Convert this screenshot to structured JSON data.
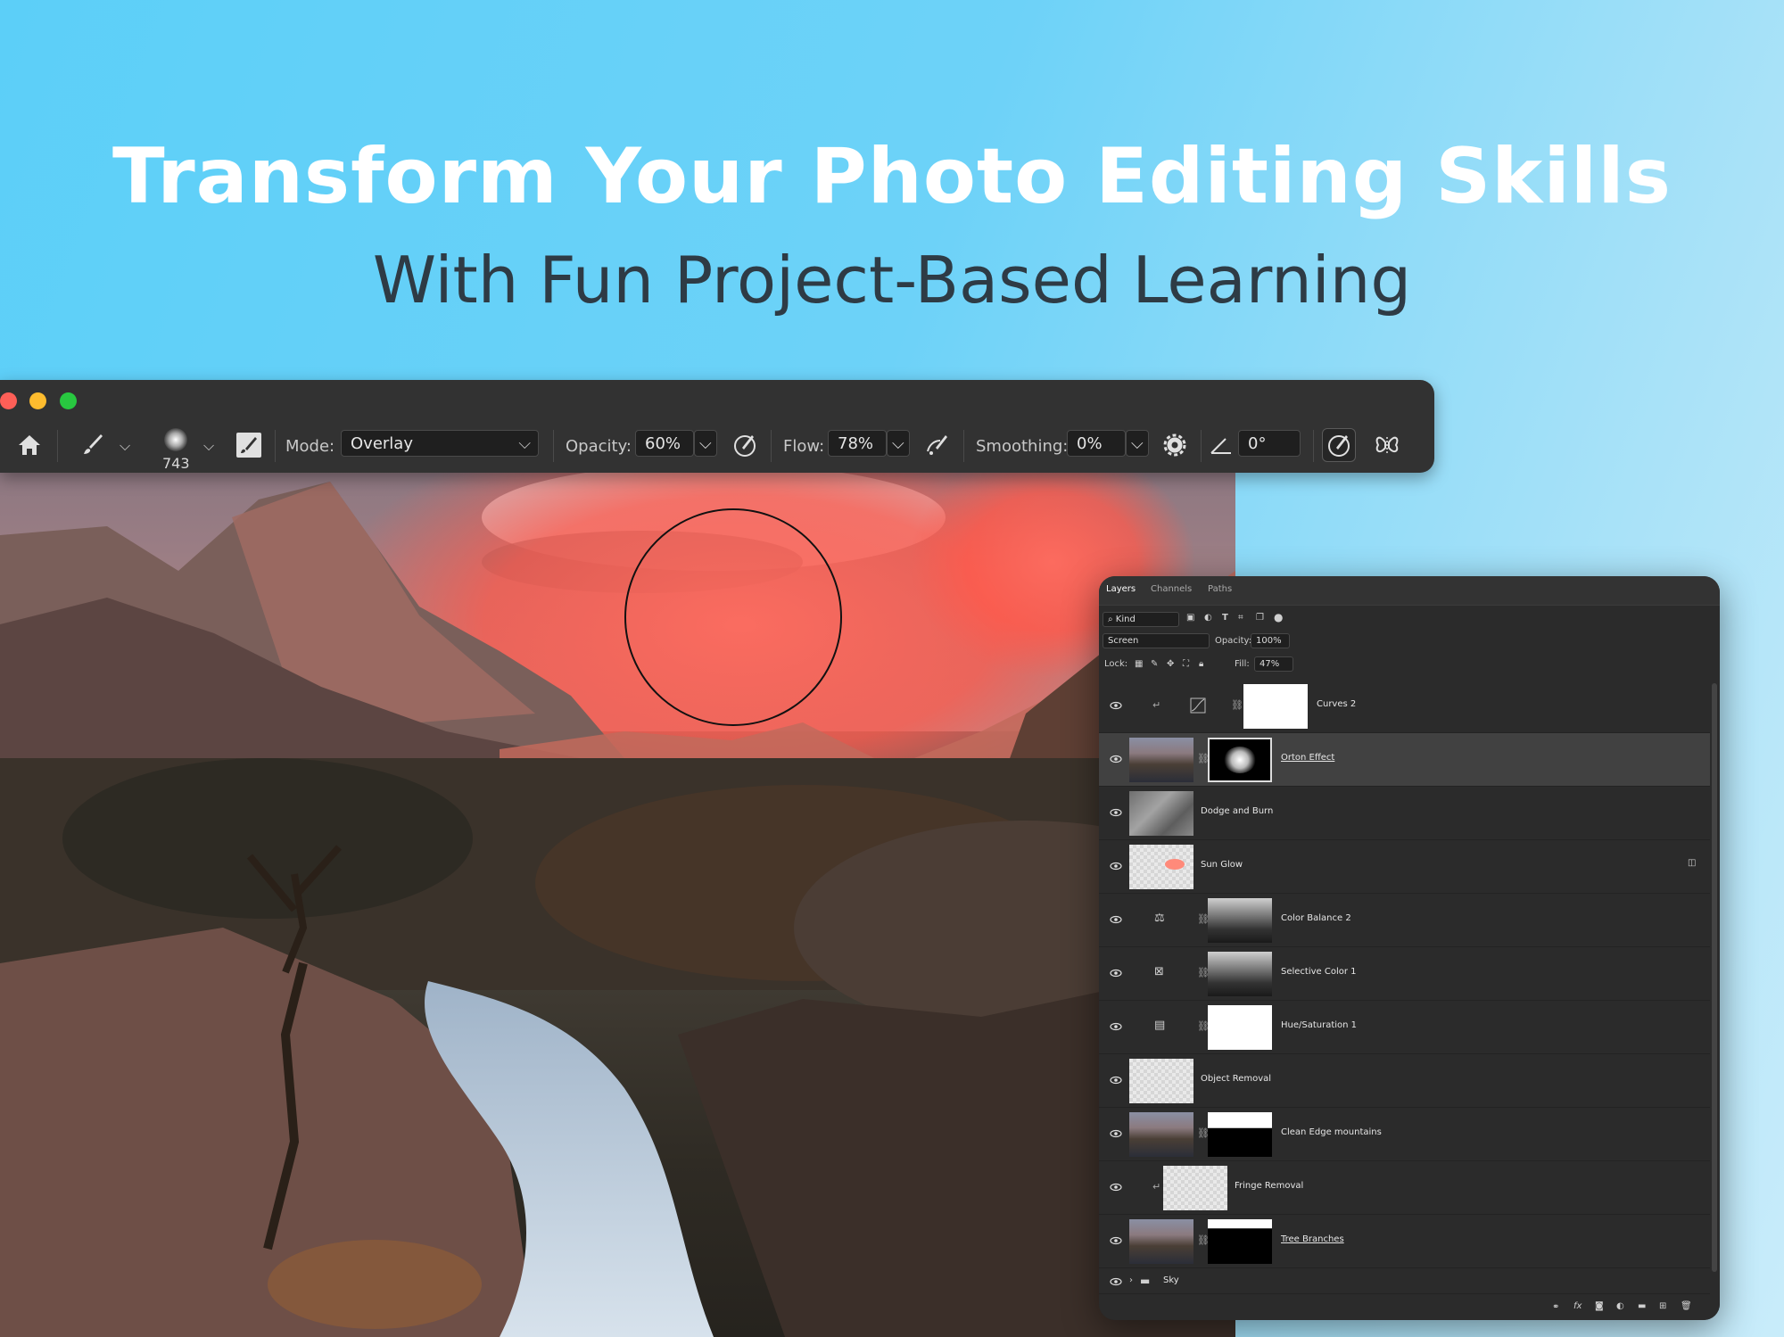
{
  "hero": {
    "title": "Transform Your Photo Editing Skills",
    "subtitle": "With Fun Project-Based Learning"
  },
  "options_bar": {
    "brush_size": "743",
    "mode_label": "Mode:",
    "mode_value": "Overlay",
    "opacity_label": "Opacity:",
    "opacity_value": "60%",
    "flow_label": "Flow:",
    "flow_value": "78%",
    "smoothing_label": "Smoothing:",
    "smoothing_value": "0%",
    "angle_value": "0°"
  },
  "layers_panel": {
    "tabs": [
      "Layers",
      "Channels",
      "Paths"
    ],
    "filter_kind": "Kind",
    "blend_mode": "Screen",
    "opacity_label": "Opacity:",
    "opacity_value": "100%",
    "lock_label": "Lock:",
    "fill_label": "Fill:",
    "fill_value": "47%",
    "layers": [
      {
        "name": "Curves 2"
      },
      {
        "name": "Orton Effect"
      },
      {
        "name": "Dodge and Burn"
      },
      {
        "name": "Sun Glow"
      },
      {
        "name": "Color Balance 2"
      },
      {
        "name": "Selective Color 1"
      },
      {
        "name": "Hue/Saturation 1"
      },
      {
        "name": "Object Removal"
      },
      {
        "name": "Clean Edge mountains"
      },
      {
        "name": "Fringe Removal"
      },
      {
        "name": "Tree Branches"
      },
      {
        "name": "Sky"
      }
    ],
    "bottom_fx": "fx"
  },
  "colors": {
    "background": "#5ccff8",
    "headline": "#ffffff",
    "subhead": "#2e3b45",
    "ui_dark": "#323232",
    "glow": "#ff5a4c"
  }
}
